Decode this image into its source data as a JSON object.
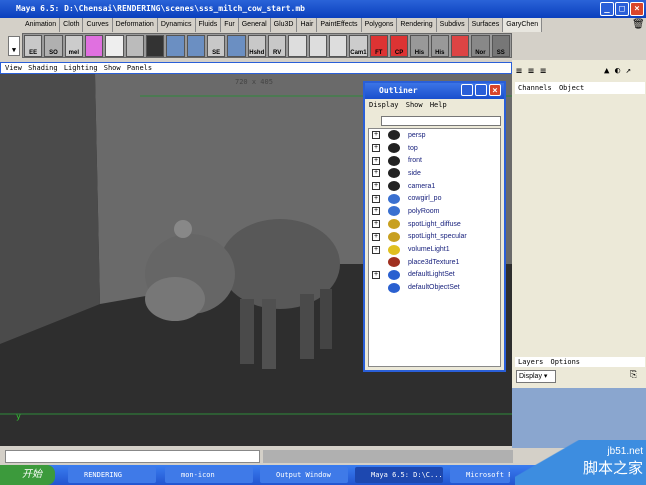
{
  "window": {
    "title": "Maya 6.5: D:\\Chensai\\RENDERING\\scenes\\sss_milch_cow_start.mb"
  },
  "shelf_tabs": [
    "Animation",
    "Cloth",
    "Curves",
    "Deformation",
    "Dynamics",
    "Fluids",
    "Fur",
    "General",
    "Glu3D",
    "Hair",
    "PaintEffects",
    "Polygons",
    "Rendering",
    "Subdivs",
    "Surfaces",
    "GaryChen"
  ],
  "shelf_buttons": [
    "EE",
    "SO",
    "mel",
    "",
    "",
    "",
    "",
    "",
    "",
    "SE",
    "",
    "Hshd",
    "RV",
    "",
    "",
    "",
    "Cam1",
    "FT",
    "CP",
    "His",
    "His",
    "",
    "Nor",
    "SS"
  ],
  "viewport": {
    "menu": [
      "View",
      "Shading",
      "Lighting",
      "Show",
      "Panels"
    ],
    "resolution": "720 x 405",
    "axis_label": "y"
  },
  "outliner": {
    "title": "Outliner",
    "menu": [
      "Display",
      "Show",
      "Help"
    ],
    "items": [
      {
        "label": "persp",
        "icon": "camera-icon",
        "expand": true
      },
      {
        "label": "top",
        "icon": "camera-icon",
        "expand": true
      },
      {
        "label": "front",
        "icon": "camera-icon",
        "expand": true
      },
      {
        "label": "side",
        "icon": "camera-icon",
        "expand": true
      },
      {
        "label": "camera1",
        "icon": "camera-icon",
        "expand": true
      },
      {
        "label": "cowgirl_po",
        "icon": "mesh-icon",
        "expand": true
      },
      {
        "label": "polyRoom",
        "icon": "mesh-icon",
        "expand": true
      },
      {
        "label": "spotLight_diffuse",
        "icon": "spotlight-icon",
        "expand": true
      },
      {
        "label": "spotLight_specular",
        "icon": "spotlight-icon",
        "expand": true
      },
      {
        "label": "volumeLight1",
        "icon": "volumelight-icon",
        "expand": true
      },
      {
        "label": "place3dTexture1",
        "icon": "texture-icon",
        "expand": false
      },
      {
        "label": "defaultLightSet",
        "icon": "set-icon",
        "expand": true
      },
      {
        "label": "defaultObjectSet",
        "icon": "set-icon",
        "expand": false
      }
    ]
  },
  "channel_box": {
    "menu": [
      "Channels",
      "Object"
    ]
  },
  "layers": {
    "menu": [
      "Layers",
      "Options"
    ],
    "dropdown": "Display"
  },
  "taskbar": {
    "start": "开始",
    "tasks": [
      "RENDERING",
      "mon-icon",
      "Output Window",
      "Maya 6.5: D:\\C...",
      "Microsoft P"
    ]
  },
  "watermark": {
    "site": "jb51.net",
    "name": "脚本之家"
  }
}
